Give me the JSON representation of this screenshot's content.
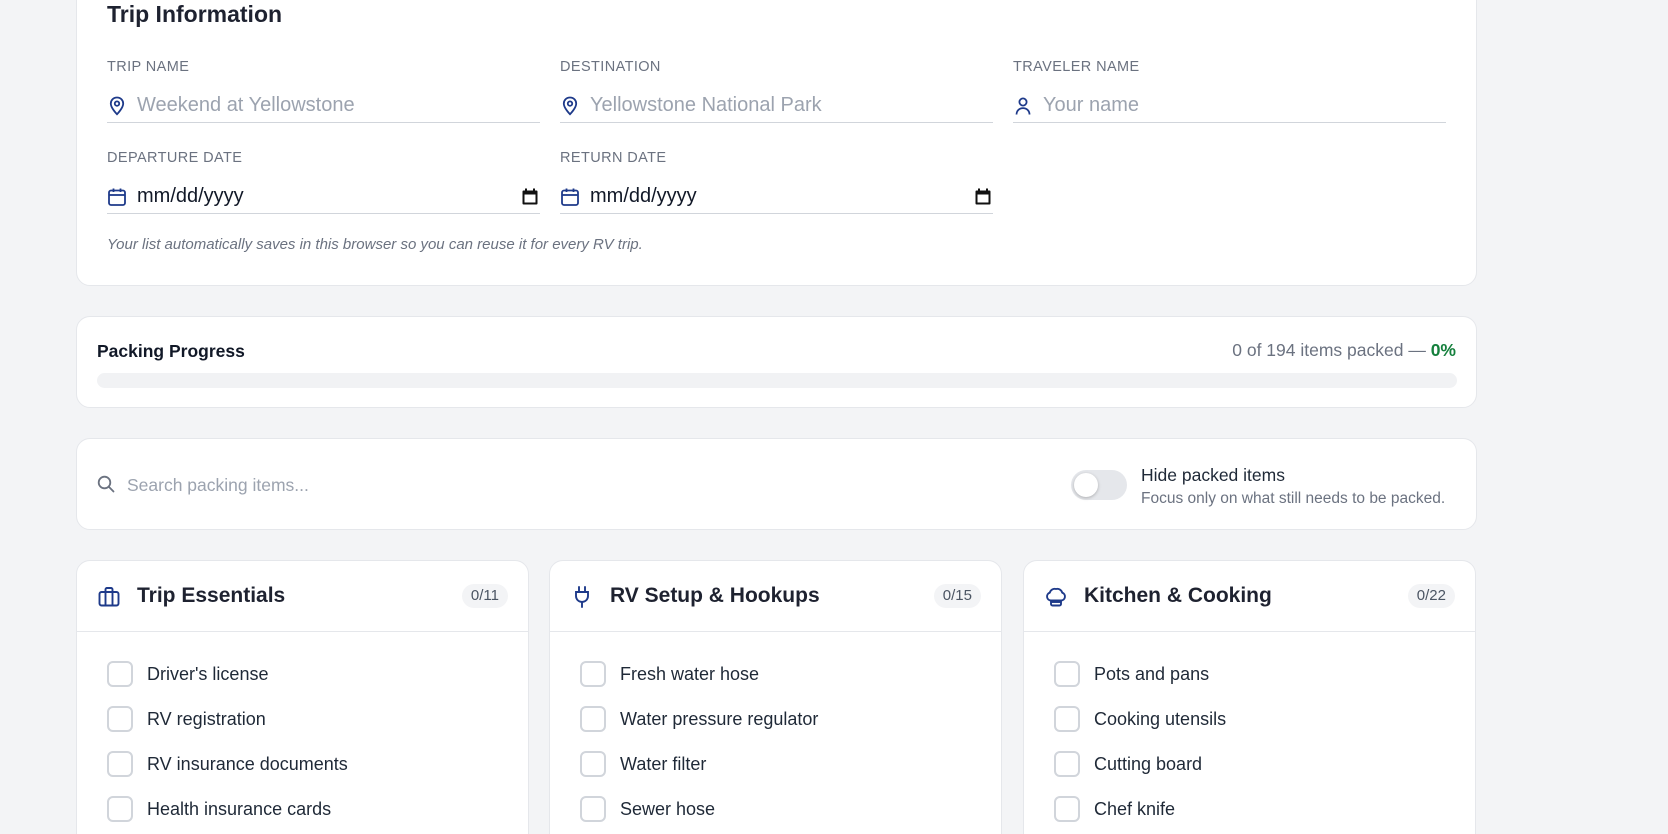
{
  "trip_info": {
    "title": "Trip Information",
    "fields": {
      "trip_name": {
        "label": "TRIP NAME",
        "placeholder": "Weekend at Yellowstone",
        "value": ""
      },
      "destination": {
        "label": "DESTINATION",
        "placeholder": "Yellowstone National Park",
        "value": ""
      },
      "traveler_name": {
        "label": "TRAVELER NAME",
        "placeholder": "Your name",
        "value": ""
      },
      "departure_date": {
        "label": "DEPARTURE DATE",
        "value": "mm/dd/yyyy"
      },
      "return_date": {
        "label": "RETURN DATE",
        "value": "mm/dd/yyyy"
      }
    },
    "note": "Your list automatically saves in this browser so you can reuse it for every RV trip."
  },
  "progress": {
    "title": "Packing Progress",
    "summary_prefix": "0 of 194 items packed — ",
    "percent_label": "0%",
    "packed": 0,
    "total": 194,
    "fraction": 0
  },
  "search": {
    "placeholder": "Search packing items...",
    "value": ""
  },
  "hide_packed": {
    "label": "Hide packed items",
    "description": "Focus only on what still needs to be packed.",
    "enabled": false
  },
  "colors": {
    "accent": "#1e3a8a",
    "progress": "#15803d",
    "page_bg": "#f3f4f6"
  },
  "categories": [
    {
      "title": "Trip Essentials",
      "count": "0/11",
      "icon": "briefcase-icon",
      "items": [
        "Driver's license",
        "RV registration",
        "RV insurance documents",
        "Health insurance cards"
      ]
    },
    {
      "title": "RV Setup & Hookups",
      "count": "0/15",
      "icon": "plug-icon",
      "items": [
        "Fresh water hose",
        "Water pressure regulator",
        "Water filter",
        "Sewer hose"
      ]
    },
    {
      "title": "Kitchen & Cooking",
      "count": "0/22",
      "icon": "chef-hat-icon",
      "items": [
        "Pots and pans",
        "Cooking utensils",
        "Cutting board",
        "Chef knife"
      ]
    }
  ]
}
